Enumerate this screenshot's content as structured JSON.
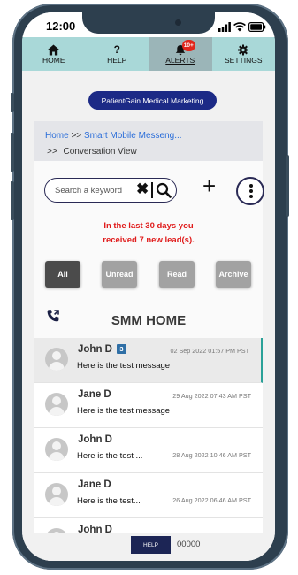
{
  "status": {
    "time": "12:00"
  },
  "nav": {
    "items": [
      {
        "label": "HOME",
        "icon": "home-icon"
      },
      {
        "label": "HELP",
        "icon": "question-icon"
      },
      {
        "label": "ALERTS",
        "icon": "bell-icon",
        "badge": "10+"
      },
      {
        "label": "SETTINGS",
        "icon": "gear-icon"
      }
    ],
    "active": "ALERTS",
    "bg_color": "#a9d8d8"
  },
  "brand": {
    "label": "PatientGain Medical Marketing",
    "color": "#1c2a86"
  },
  "breadcrumb": {
    "home": "Home",
    "sep": ">>",
    "section": "Smart Mobile Messeng...",
    "current_prefix": ">>",
    "current": "Conversation View"
  },
  "search": {
    "placeholder": "Search a keyword"
  },
  "notice": {
    "line1": "In the last 30 days you",
    "line2": "received 7 new lead(s).",
    "color": "#e01b1b"
  },
  "filters": [
    {
      "label": "All",
      "active": true
    },
    {
      "label": "Unread",
      "active": false
    },
    {
      "label": "Read",
      "active": false
    },
    {
      "label": "Archive",
      "active": false
    }
  ],
  "section_title": "SMM HOME",
  "conversations": [
    {
      "name": "John D",
      "count": "3",
      "date": "02 Sep 2022 01:57 PM PST",
      "message": "Here is the test message",
      "selected": true
    },
    {
      "name": "Jane D",
      "count": "",
      "date": "29 Aug 2022 07:43 AM PST",
      "message": "Here is the test message",
      "selected": false
    },
    {
      "name": "John D",
      "count": "",
      "date": "28 Aug 2022 10:46 AM PST",
      "message": "Here is the test ...",
      "selected": false
    },
    {
      "name": "Jane D",
      "count": "",
      "date": "26 Aug 2022 06:46 AM PST",
      "message": "Here is the test...",
      "selected": false
    },
    {
      "name": "John D",
      "count": "",
      "date": "",
      "message": "",
      "selected": false
    }
  ],
  "footer": {
    "help_label": "HELP",
    "code": "00000"
  }
}
